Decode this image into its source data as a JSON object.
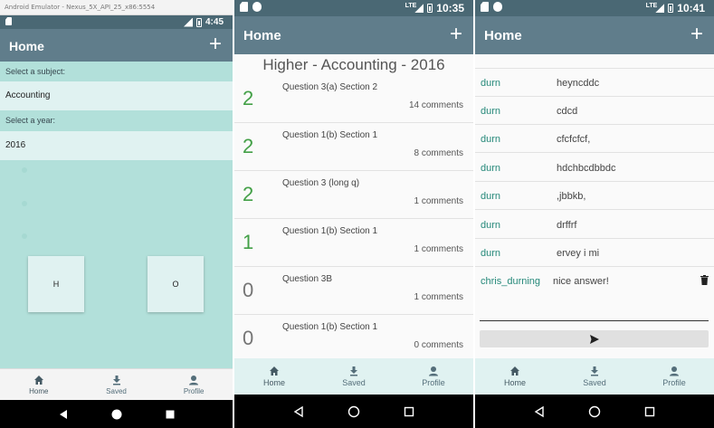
{
  "screen1": {
    "emulator_title": "Android Emulator - Nexus_5X_API_25_x86:5554",
    "status_time": "4:45",
    "app_title": "Home",
    "subject_label": "Select a subject:",
    "subject_value": "Accounting",
    "year_label": "Select a year:",
    "year_value": "2016",
    "buttons": [
      "H",
      "O"
    ],
    "nav": [
      {
        "label": "Home",
        "icon": "home-icon"
      },
      {
        "label": "Saved",
        "icon": "download-icon"
      },
      {
        "label": "Profile",
        "icon": "person-icon"
      }
    ]
  },
  "screen2": {
    "status_time": "10:35",
    "app_title": "Home",
    "heading": "Higher - Accounting - 2016",
    "questions": [
      {
        "score": "2",
        "name": "Question 3(a) Section 2",
        "comments": "14 comments"
      },
      {
        "score": "2",
        "name": "Question 1(b) Section 1",
        "comments": "8 comments"
      },
      {
        "score": "2",
        "name": "Question 3 (long q)",
        "comments": "1 comments"
      },
      {
        "score": "1",
        "name": "Question 1(b) Section 1",
        "comments": "1 comments"
      },
      {
        "score": "0",
        "name": "Question 3B",
        "comments": "1 comments"
      },
      {
        "score": "0",
        "name": "Question 1(b) Section 1",
        "comments": "0 comments"
      }
    ],
    "nav": [
      {
        "label": "Home",
        "icon": "home-icon"
      },
      {
        "label": "Saved",
        "icon": "download-icon"
      },
      {
        "label": "Profile",
        "icon": "person-icon"
      }
    ]
  },
  "screen3": {
    "status_time": "10:41",
    "app_title": "Home",
    "comments": [
      {
        "user": "durn",
        "text": "heyncddc"
      },
      {
        "user": "durn",
        "text": "cdcd"
      },
      {
        "user": "durn",
        "text": "cfcfcfcf,"
      },
      {
        "user": "durn",
        "text": "hdchbcdbbdc"
      },
      {
        "user": "durn",
        "text": ",jbbkb,"
      },
      {
        "user": "durn",
        "text": "drffrf"
      },
      {
        "user": "durn",
        "text": "ervey i mi"
      },
      {
        "user": "chris_durning",
        "text": "nice answer!"
      }
    ],
    "nav": [
      {
        "label": "Home",
        "icon": "home-icon"
      },
      {
        "label": "Saved",
        "icon": "download-icon"
      },
      {
        "label": "Profile",
        "icon": "person-icon"
      }
    ]
  },
  "colors": {
    "appbar": "#607d8b",
    "statusbar": "#4a6874",
    "teal_bg": "#b2e0da",
    "score_green": "#43a047",
    "user_teal": "#26897a"
  }
}
